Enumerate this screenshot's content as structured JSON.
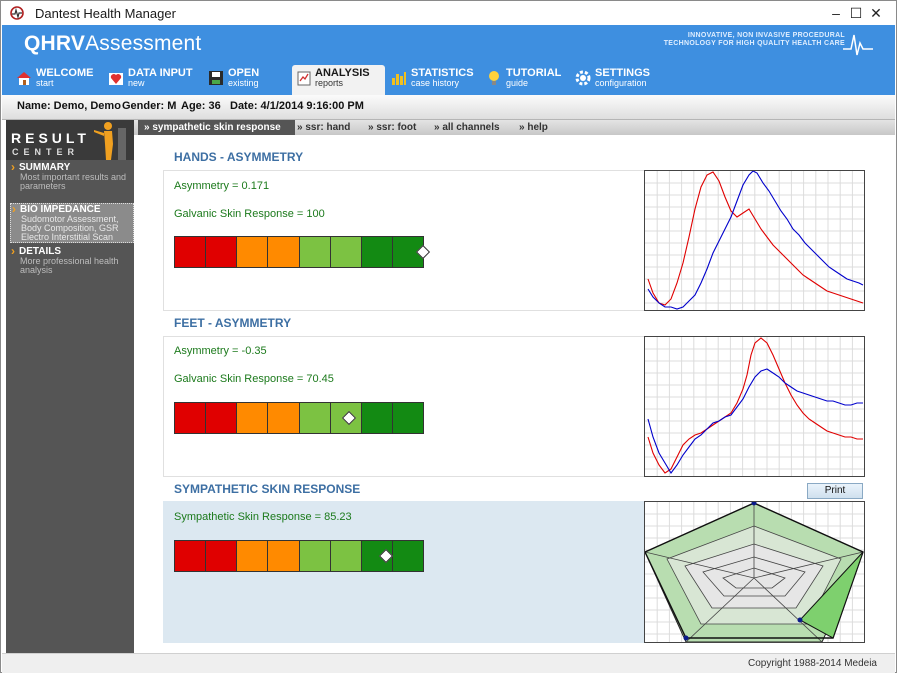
{
  "window": {
    "title": "Dantest Health Manager"
  },
  "header": {
    "brand_bold": "QHRV",
    "brand_rest": "Assessment",
    "tagline_line1": "INNOVATIVE, NON INVASIVE PROCEDURAL",
    "tagline_line2": "TECHNOLOGY FOR HIGH QUALITY HEALTH CARE"
  },
  "nav": [
    {
      "label": "WELCOME",
      "sub": "start",
      "icon": "home-icon"
    },
    {
      "label": "DATA INPUT",
      "sub": "new",
      "icon": "heart-icon"
    },
    {
      "label": "OPEN",
      "sub": "existing",
      "icon": "floppy-icon"
    },
    {
      "label": "ANALYSIS",
      "sub": "reports",
      "icon": "notepad-icon",
      "active": true
    },
    {
      "label": "STATISTICS",
      "sub": "case history",
      "icon": "bar-chart-icon"
    },
    {
      "label": "TUTORIAL",
      "sub": "guide",
      "icon": "lightbulb-icon"
    },
    {
      "label": "SETTINGS",
      "sub": "configuration",
      "icon": "gear-icon"
    }
  ],
  "patient": {
    "name": "Name: Demo, Demo",
    "gender": "Gender: M",
    "age": "Age: 36",
    "date": "Date: 4/1/2014 9:16:00 PM"
  },
  "sidebar": {
    "title": "RESULT",
    "subtitle": "CENTER",
    "items": [
      {
        "title": "SUMMARY",
        "desc": "Most important results and parameters"
      },
      {
        "title": "BIO IMPEDANCE",
        "desc": "Sudomotor Assessment, Body Composition, GSR Electro Interstitial Scan",
        "active": true
      },
      {
        "title": "DETAILS",
        "desc": "More professional health analysis"
      }
    ]
  },
  "subnav": [
    {
      "label": "» sympathetic skin response",
      "active": true
    },
    {
      "label": "» ssr: hand"
    },
    {
      "label": "» ssr: foot"
    },
    {
      "label": "» all channels"
    },
    {
      "label": "» help"
    }
  ],
  "scale_colors": [
    "#e00000",
    "#e00000",
    "#ff8a00",
    "#ff8a00",
    "#7cc242",
    "#7cc242",
    "#138a13",
    "#138a13"
  ],
  "sections": {
    "hands": {
      "title": "HANDS - ASYMMETRY",
      "asymmetry": "Asymmetry = 0.171",
      "gsr": "Galvanic Skin Response = 100",
      "marker_fraction": 1.0
    },
    "feet": {
      "title": "FEET - ASYMMETRY",
      "asymmetry": "Asymmetry = -0.35",
      "gsr": "Galvanic Skin Response = 70.45",
      "marker_fraction": 0.7
    },
    "ssr": {
      "title": "SYMPATHETIC SKIN RESPONSE",
      "value": "Sympathetic Skin Response = 85.23",
      "marker_fraction": 0.85,
      "print_label": "Print"
    }
  },
  "footer": {
    "copyright": "Copyright 1988-2014 Medeia"
  }
}
